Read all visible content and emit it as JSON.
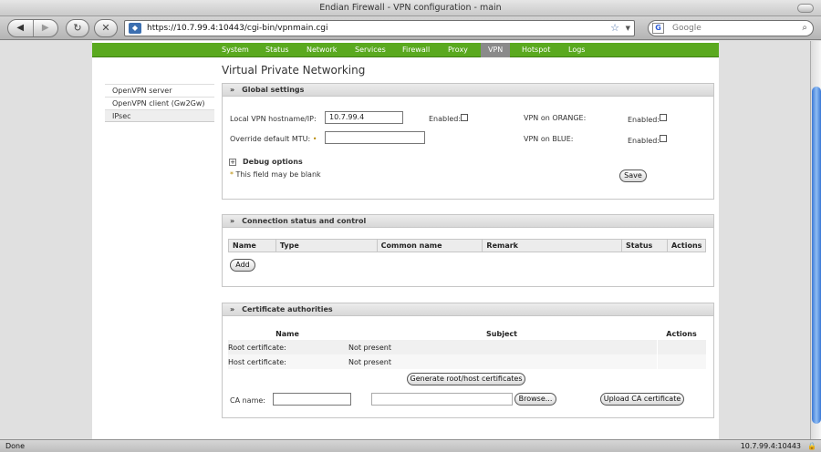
{
  "window": {
    "title": "Endian Firewall - VPN configuration - main"
  },
  "toolbar": {
    "back_glyph": "◀",
    "forward_glyph": "▶",
    "reload_glyph": "↻",
    "stop_glyph": "✕",
    "url": "https://10.7.99.4:10443/cgi-bin/vpnmain.cgi",
    "bookmark_glyph": "☆",
    "search_engine_glyph": "G",
    "search_placeholder": "Google",
    "search_glyph": "⌕"
  },
  "menu": [
    "System",
    "Status",
    "Network",
    "Services",
    "Firewall",
    "Proxy",
    "VPN",
    "Hotspot",
    "Logs"
  ],
  "menu_active": "VPN",
  "sidebar": [
    "OpenVPN server",
    "OpenVPN client (Gw2Gw)",
    "IPsec"
  ],
  "page_title": "Virtual Private Networking",
  "global": {
    "header": "Global settings",
    "chevron": "»",
    "hostname_label": "Local VPN hostname/IP:",
    "hostname_value": "10.7.99.4",
    "enabled_label": "Enabled:",
    "mtu_label": "Override default MTU:",
    "mtu_value": "",
    "orange_label": "VPN on ORANGE:",
    "orange_enabled_label": "Enabled:",
    "blue_label": "VPN on BLUE:",
    "blue_enabled_label": "Enabled:",
    "debug_toggle": "+",
    "debug_label": "Debug options",
    "blank_note": "This field may be blank",
    "blank_marker": "*",
    "save_label": "Save"
  },
  "connections": {
    "header": "Connection status and control",
    "chevron": "»",
    "columns": [
      "Name",
      "Type",
      "Common name",
      "Remark",
      "Status",
      "Actions"
    ],
    "add_label": "Add"
  },
  "ca": {
    "header": "Certificate authorities",
    "chevron": "»",
    "columns": [
      "Name",
      "Subject",
      "Actions"
    ],
    "rows": [
      {
        "name": "Root certificate:",
        "subject": "Not present"
      },
      {
        "name": "Host certificate:",
        "subject": "Not present"
      }
    ],
    "generate_label": "Generate root/host certificates",
    "ca_name_label": "CA name:",
    "ca_name_value": "",
    "browse_label": "Browse...",
    "upload_label": "Upload CA certificate"
  },
  "status_bar": {
    "left": "Done",
    "right": "10.7.99.4:10443",
    "lock_glyph": "🔒"
  }
}
